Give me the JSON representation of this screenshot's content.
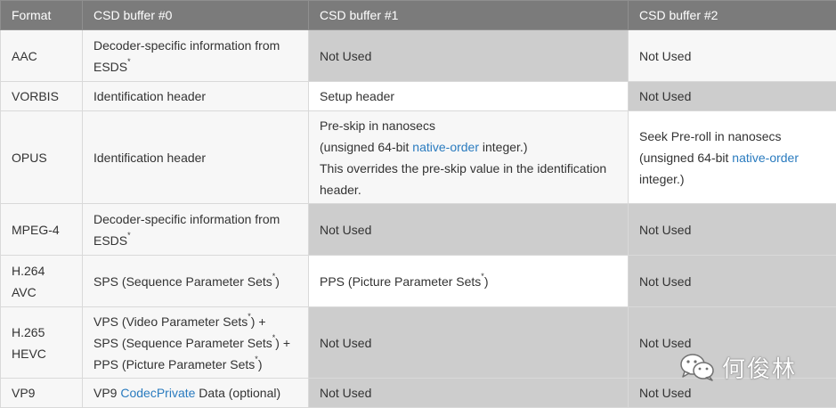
{
  "headers": [
    "Format",
    "CSD buffer #0",
    "CSD buffer #1",
    "CSD buffer #2"
  ],
  "rows": {
    "aac": {
      "format": "AAC",
      "csd0_text": "Decoder-specific information from ESDS",
      "csd0_sup": "*",
      "csd1": "Not Used",
      "csd2": "Not Used"
    },
    "vorbis": {
      "format": "VORBIS",
      "csd0": "Identification header",
      "csd1": "Setup header",
      "csd2": "Not Used"
    },
    "opus": {
      "format": "OPUS",
      "csd0": "Identification header",
      "csd1_line1": "Pre-skip in nanosecs",
      "csd1_line2_pre": "(unsigned 64-bit ",
      "csd1_link": "native-order",
      "csd1_line2_post": " integer.)",
      "csd1_line3": "This overrides the pre-skip value in the identification header.",
      "csd2_line1": "Seek Pre-roll in nanosecs",
      "csd2_line2_pre": "(unsigned 64-bit ",
      "csd2_link": "native-order",
      "csd2_line2_post": " integer.)"
    },
    "mpeg4": {
      "format": "MPEG-4",
      "csd0_text": "Decoder-specific information from ESDS",
      "csd0_sup": "*",
      "csd1": "Not Used",
      "csd2": "Not Used"
    },
    "h264": {
      "format_line1": "H.264",
      "format_line2": "AVC",
      "csd0_text": "SPS (Sequence Parameter Sets",
      "csd0_sup": "*",
      "csd0_close": ")",
      "csd1_text": "PPS (Picture Parameter Sets",
      "csd1_sup": "*",
      "csd1_close": ")",
      "csd2": "Not Used"
    },
    "h265": {
      "format_line1": "H.265",
      "format_line2": "HEVC",
      "csd0_l1_text": "VPS (Video Parameter Sets",
      "csd0_l1_sup": "*",
      "csd0_l1_close": ") +",
      "csd0_l2_text": "SPS (Sequence Parameter Sets",
      "csd0_l2_sup": "*",
      "csd0_l2_close": ") +",
      "csd0_l3_text": "PPS (Picture Parameter Sets",
      "csd0_l3_sup": "*",
      "csd0_l3_close": ")",
      "csd1": "Not Used",
      "csd2": "Not Used"
    },
    "vp9": {
      "format": "VP9",
      "csd0_pre": "VP9 ",
      "csd0_link": "CodecPrivate",
      "csd0_post": " Data (optional)",
      "csd1": "Not Used",
      "csd2": "Not Used"
    }
  },
  "watermark": {
    "text": "何俊林",
    "icon": "wechat-icon"
  },
  "colors": {
    "header_bg": "#7b7b7b",
    "not_used_bg": "#cdcdcd",
    "cell_bg": "#f7f7f7",
    "link": "#2a7bbf"
  }
}
